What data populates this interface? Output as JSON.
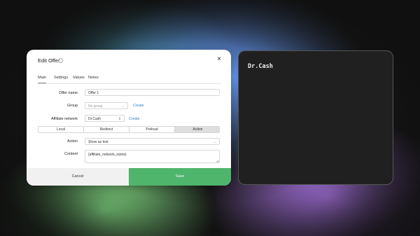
{
  "dialog": {
    "title": "Edit Offer",
    "info_icon": "info-icon",
    "close_icon": "×",
    "tabs": [
      {
        "label": "Main",
        "active": true
      },
      {
        "label": "Settings",
        "active": false
      },
      {
        "label": "Values",
        "active": false
      },
      {
        "label": "Notes",
        "active": false
      }
    ],
    "fields": {
      "offer_name": {
        "label": "Offer name",
        "value": "Offer 1"
      },
      "group": {
        "label": "Group",
        "placeholder": "No group",
        "create_link": "Create"
      },
      "affiliate_network": {
        "label": "Affiliate network",
        "value": "Dr.Cash",
        "create_link": "Create"
      },
      "action": {
        "label": "Action",
        "value": "Show as text"
      },
      "content": {
        "label": "Content",
        "value": "{affiliate_network_name}"
      }
    },
    "mode_options": [
      {
        "label": "Local",
        "active": false
      },
      {
        "label": "Redirect",
        "active": false
      },
      {
        "label": "Preload",
        "active": false
      },
      {
        "label": "Action",
        "active": true
      }
    ],
    "footer": {
      "cancel_label": "Cancel",
      "save_label": "Save"
    }
  },
  "preview": {
    "text": "Dr.Cash"
  },
  "colors": {
    "save": "#4fb56c",
    "link": "#2f83c9",
    "preview_bg": "#202020"
  }
}
